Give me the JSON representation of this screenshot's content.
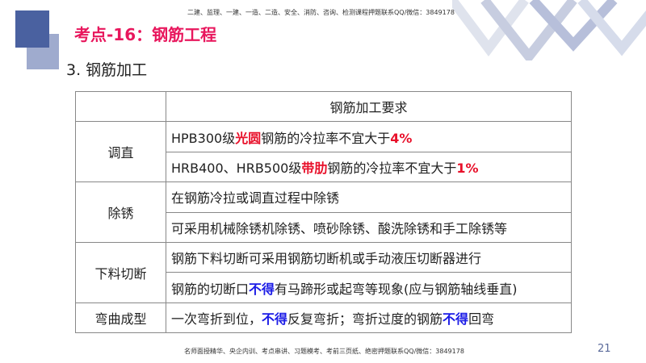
{
  "header": {
    "top_note": "二建、监理、一建、一造、二造、安全、消防、咨询、检测课程押题联系QQ/微信：3849178",
    "title": "考点-16：钢筋工程",
    "subtitle": "3. 钢筋加工"
  },
  "table": {
    "header": "钢筋加工要求",
    "rows": [
      {
        "group": "调直",
        "lines": [
          [
            "HPB300级",
            "光圆",
            "钢筋的冷拉率不宜大于",
            "4%"
          ],
          [
            "HRB400、HRB500级",
            "带肋",
            "钢筋的冷拉率不宜大于",
            "1%"
          ]
        ]
      },
      {
        "group": "除锈",
        "lines": [
          [
            "在钢筋冷拉或调直过程中除锈"
          ],
          [
            "可采用机械除锈机除锈、喷砂除锈、酸洗除锈和手工除锈等"
          ]
        ]
      },
      {
        "group": "下料切断",
        "lines": [
          [
            "钢筋下料切断可采用钢筋切断机或手动液压切断器进行"
          ],
          [
            "钢筋的切断口",
            "不得",
            "有马蹄形或起弯等现象(应与钢筋轴线垂直)"
          ]
        ]
      },
      {
        "group": "弯曲成型",
        "lines": [
          [
            "一次弯折到位，",
            "不得",
            "反复弯折；弯折过度的钢筋",
            "不得",
            "回弯"
          ]
        ]
      }
    ]
  },
  "footer": {
    "note": "名师面授精华、央企内训、考点串讲、习题模考、考前三页纸、绝密押题联系QQ/微信：3849178",
    "page": "21"
  },
  "colors": {
    "title": "#e8175d",
    "red": "#e8102a",
    "blue": "#1a1ae6"
  }
}
